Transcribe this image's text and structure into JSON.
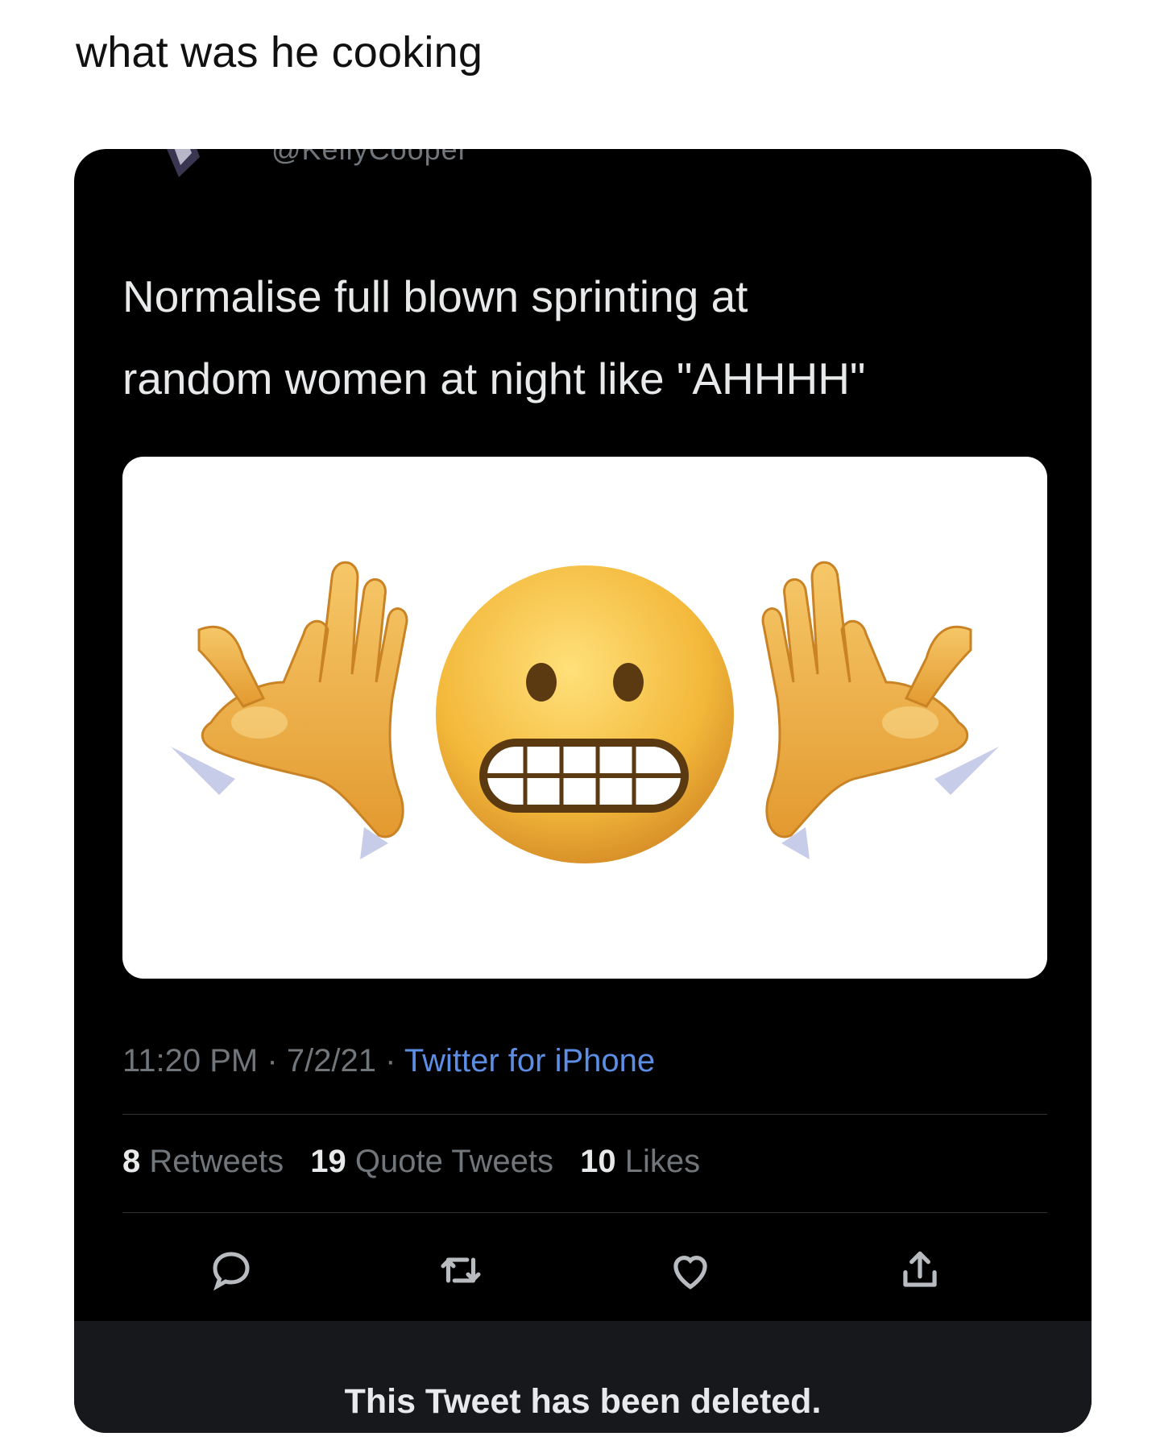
{
  "post": {
    "caption": "what was he cooking"
  },
  "tweet": {
    "handle": "@KellyCooper",
    "text_line1": "Normalise full blown sprinting at",
    "text_line2": "random women at night like \"AHHHH\"",
    "media": {
      "icons": [
        "grabbing-hand-icon",
        "grimacing-face-icon",
        "grabbing-hand-icon"
      ]
    },
    "time": "11:20 PM",
    "separator": "·",
    "date": "7/2/21",
    "source": "Twitter for iPhone",
    "stats": {
      "retweets_count": "8",
      "retweets_label": "Retweets",
      "quotes_count": "19",
      "quotes_label": "Quote Tweets",
      "likes_count": "10",
      "likes_label": "Likes"
    },
    "actions": [
      "reply-icon",
      "retweet-icon",
      "like-icon",
      "share-icon"
    ],
    "deleted_notice": "This Tweet has been deleted."
  },
  "colors": {
    "card_background": "#000000",
    "text_primary": "#e7e9ea",
    "text_secondary": "#71767b",
    "link": "#5c8ee6",
    "deleted_bar": "#16181c"
  }
}
